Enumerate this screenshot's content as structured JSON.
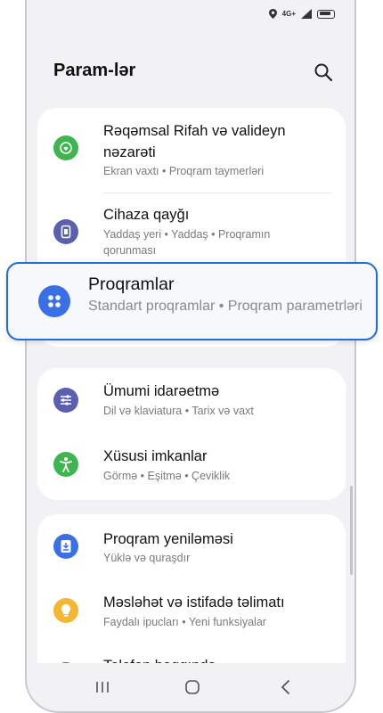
{
  "status": {
    "network": "4G+"
  },
  "header": {
    "title": "Param-lər",
    "search_icon": "search-icon"
  },
  "card1": {
    "items": [
      {
        "title_line1": "Rəqəmsal Rifah və valideyn",
        "title_line2": "nəzarəti",
        "subtitle": "Ekran vaxtı  •  Proqram taymerləri",
        "icon": "digital-wellbeing-icon",
        "color": "#3fb54f"
      },
      {
        "title": "Cihaza qayğı",
        "subtitle_line1": "Yaddaş yeri  •  Yaddaş  •  Proqramın",
        "subtitle_line2": "qorunması",
        "icon": "device-care-icon",
        "color": "#5a5fb0"
      }
    ]
  },
  "apps": {
    "title": "Proqramlar",
    "subtitle": "Standart proqramlar  •  Proqram parametrləri",
    "icon": "apps-icon",
    "color": "#3a6fe8"
  },
  "card2": {
    "items": [
      {
        "title": "Ümumi idarəetmə",
        "subtitle": "Dil və klaviatura  •  Tarix və vaxt",
        "icon": "general-management-icon",
        "color": "#5a5fb0"
      },
      {
        "title": "Xüsusi imkanlar",
        "subtitle": "Görmə  •  Eşitmə  •  Çeviklik",
        "icon": "accessibility-icon",
        "color": "#3fb54f"
      }
    ]
  },
  "card3": {
    "items": [
      {
        "title": "Proqram yeniləməsi",
        "subtitle": "Yüklə və quraşdır",
        "icon": "software-update-icon",
        "color": "#3a6fe8"
      },
      {
        "title": "Məsləhət və istifadə təlimatı",
        "subtitle": "Faydalı ipucları  •  Yeni funksiyalar",
        "icon": "tips-icon",
        "color": "#f5b731"
      },
      {
        "title": "Telefon haqqında",
        "icon": "about-phone-icon",
        "color": "#5a5fb0"
      }
    ]
  },
  "navbar": {
    "recent": "recent-apps-icon",
    "home": "home-icon",
    "back": "back-icon"
  }
}
